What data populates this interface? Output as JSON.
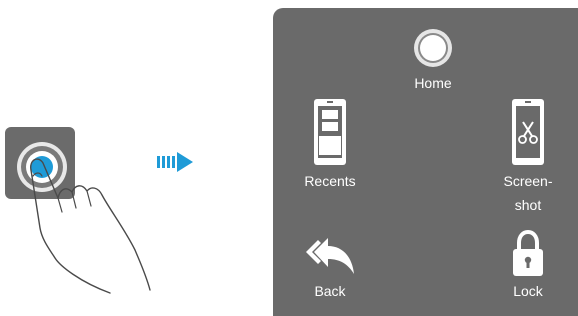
{
  "colors": {
    "panel": "#6a6a6a",
    "dock": "#6b6b6b",
    "accent": "#1f9bd7",
    "arrow": "#1f9bd7"
  },
  "panel": {
    "items": [
      {
        "id": "home",
        "label": "Home",
        "icon": "home-circle-icon"
      },
      {
        "id": "recents",
        "label": "Recents",
        "icon": "recents-phone-icon"
      },
      {
        "id": "screenshot",
        "label_line1": "Screen-",
        "label_line2": "shot",
        "icon": "screenshot-phone-icon"
      },
      {
        "id": "back",
        "label": "Back",
        "icon": "back-arrow-icon"
      },
      {
        "id": "lock",
        "label": "Lock",
        "icon": "lock-icon"
      }
    ]
  }
}
